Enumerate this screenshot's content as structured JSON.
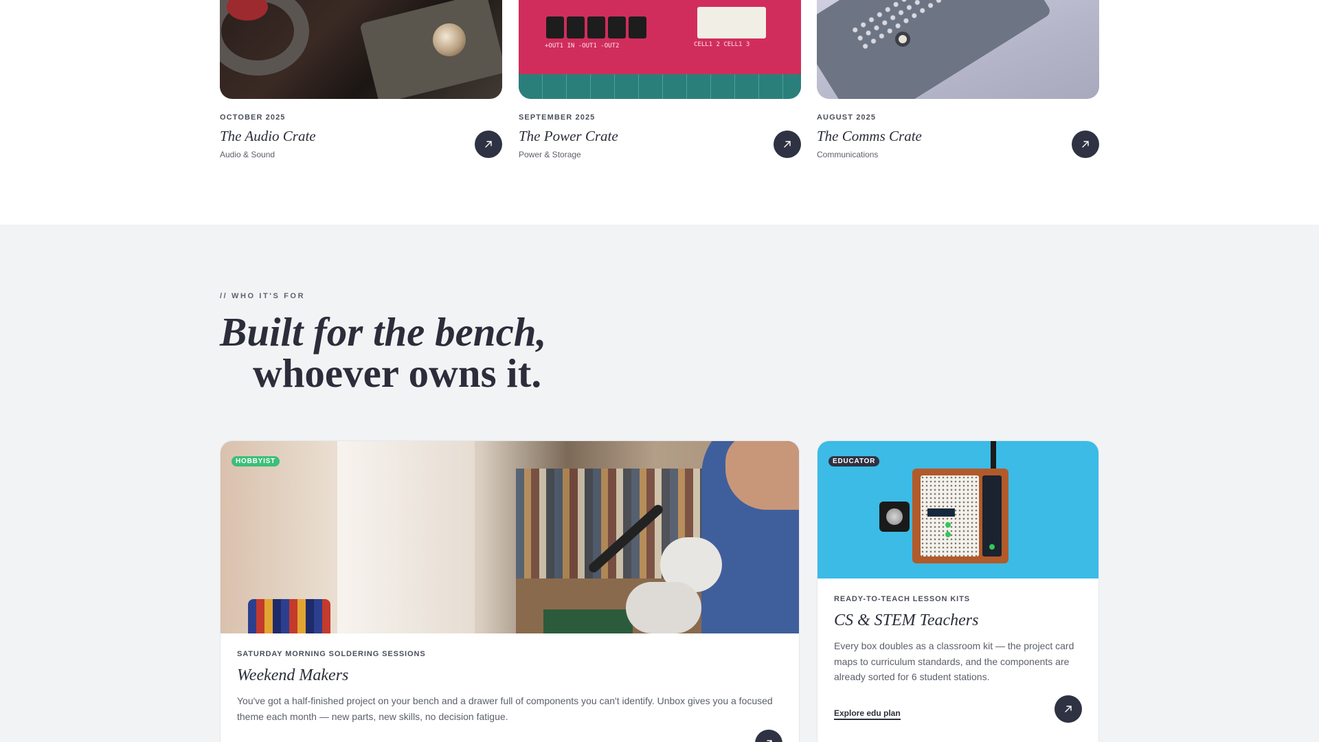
{
  "crates": [
    {
      "month": "OCTOBER 2025",
      "title": "The Audio Crate",
      "category": "Audio & Sound"
    },
    {
      "month": "SEPTEMBER 2025",
      "title": "The Power Crate",
      "category": "Power & Storage"
    },
    {
      "month": "AUGUST 2025",
      "title": "The Comms Crate",
      "category": "Communications"
    }
  ],
  "audience": {
    "eyebrow": "// WHO IT'S FOR",
    "headline_line1": "Built for the bench,",
    "headline_line2": "whoever owns it.",
    "cards": [
      {
        "badge": "HOBBYIST",
        "kicker": "SATURDAY MORNING SOLDERING SESSIONS",
        "title": "Weekend Makers",
        "description": "You've got a half-finished project on your bench and a drawer full of components you can't identify. Unbox gives you a focused theme each month — new parts, new skills, no decision fatigue."
      },
      {
        "badge": "EDUCATOR",
        "kicker": "READY-TO-TEACH LESSON KITS",
        "title": "CS & STEM Teachers",
        "description": "Every box doubles as a classroom kit — the project card maps to curriculum standards, and the components are already sorted for 6 student stations.",
        "link": "Explore edu plan"
      }
    ]
  },
  "colors": {
    "accent_dark": "#2f3242",
    "badge_green": "#3cbf78",
    "section_bg": "#f2f3f5"
  },
  "icons": {
    "card_action": "arrow-up-right-icon"
  }
}
